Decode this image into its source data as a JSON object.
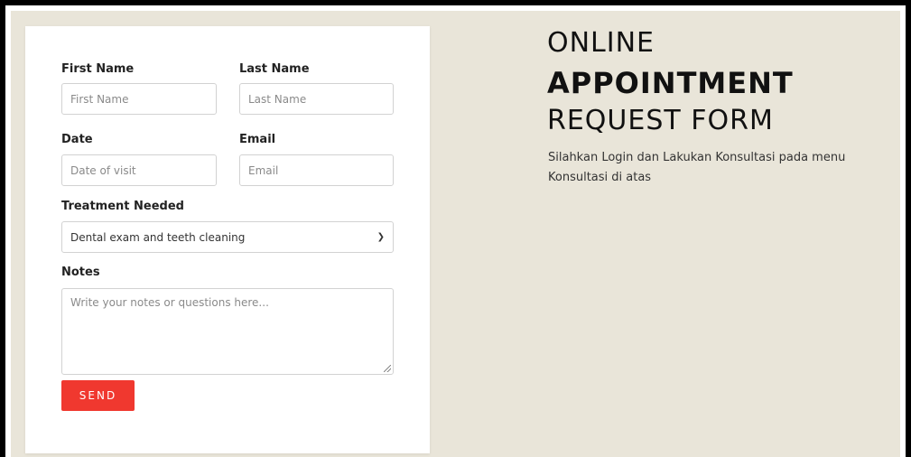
{
  "form": {
    "first_name_label": "First Name",
    "first_name_placeholder": "First Name",
    "last_name_label": "Last Name",
    "last_name_placeholder": "Last Name",
    "date_label": "Date",
    "date_placeholder": "Date of visit",
    "email_label": "Email",
    "email_placeholder": "Email",
    "treatment_label": "Treatment Needed",
    "treatment_selected": "Dental exam and teeth cleaning",
    "notes_label": "Notes",
    "notes_placeholder": "Write your notes or questions here...",
    "send_label": "SEND"
  },
  "hero": {
    "line1": "ONLINE",
    "line2": "APPOINTMENT",
    "line3": "REQUEST FORM",
    "description": "Silahkan Login dan Lakukan Konsultasi pada menu Konsultasi di atas"
  },
  "colors": {
    "background": "#e9e5d9",
    "button": "#f0382f",
    "frame": "#000000"
  },
  "icons": {
    "select_chevron": "chevron-down-icon"
  }
}
